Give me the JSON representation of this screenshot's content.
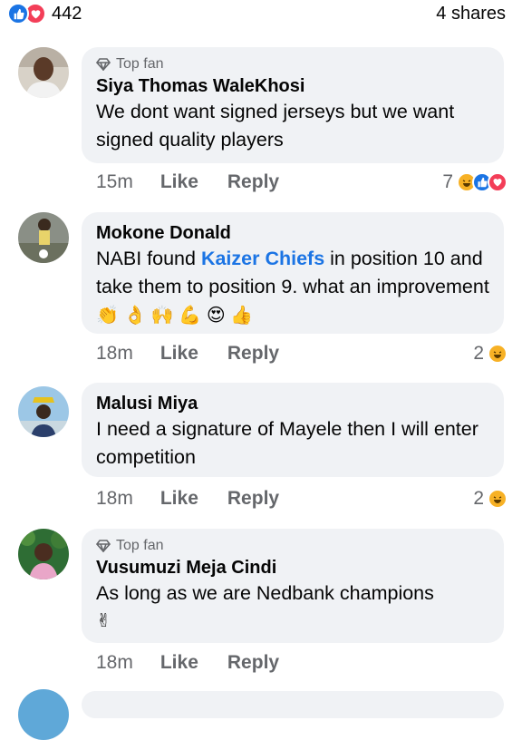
{
  "post_stats": {
    "reaction_count": "442",
    "shares": "4 shares",
    "reaction_icons": [
      "like-icon",
      "love-icon"
    ]
  },
  "comments": [
    {
      "badge": "Top fan",
      "author": "Siya Thomas WaleKhosi",
      "text": "We dont want signed jerseys but we want signed quality players",
      "time": "15m",
      "like_label": "Like",
      "reply_label": "Reply",
      "reaction_count": "7",
      "reaction_icons": [
        "haha-icon",
        "like-icon",
        "love-icon"
      ]
    },
    {
      "author": "Mokone Donald",
      "text_before": "NABI found ",
      "mention": "Kaizer Chiefs",
      "text_after": " in position 10 and take them to position 9.  what an improvement ",
      "emojis": "👏 👌 🙌 💪 😍 👍",
      "time": "18m",
      "like_label": "Like",
      "reply_label": "Reply",
      "reaction_count": "2",
      "reaction_icons": [
        "haha-icon"
      ]
    },
    {
      "author": "Malusi Miya",
      "text": "I need a signature of Mayele then I will enter competition",
      "time": "18m",
      "like_label": "Like",
      "reply_label": "Reply",
      "reaction_count": "2",
      "reaction_icons": [
        "haha-icon"
      ]
    },
    {
      "badge": "Top fan",
      "author": "Vusumuzi Meja Cindi",
      "text": "As long as we are Nedbank champions",
      "emojis": "✌",
      "time": "18m",
      "like_label": "Like",
      "reply_label": "Reply"
    }
  ],
  "colors": {
    "accent": "#1b74e4",
    "love": "#f33e58",
    "haha": "#f7b125",
    "bubble": "#f0f2f5",
    "secondary_text": "#65676b"
  }
}
